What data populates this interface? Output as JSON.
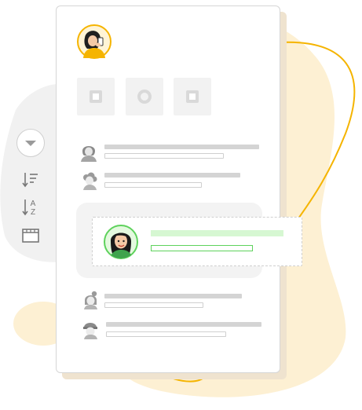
{
  "illustration": {
    "toolbar_tiles": [
      "square-stop-icon",
      "circle-record-icon",
      "square-stop-icon"
    ],
    "list_rows": [
      {
        "avatar": "woman-short-hair-avatar"
      },
      {
        "avatar": "woman-curly-hair-avatar"
      },
      {
        "avatar": "woman-dark-hair-avatar",
        "selected": true
      },
      {
        "avatar": "woman-bun-hair-avatar"
      },
      {
        "avatar": "woman-beanie-avatar"
      }
    ],
    "side_tools": [
      "dropdown-icon",
      "sort-descending-icon",
      "sort-a-z-icon",
      "calendar-icon"
    ],
    "sort_letters": {
      "top": "A",
      "bottom": "Z"
    },
    "colors": {
      "accent_yellow": "#f5b400",
      "blob_cream": "#fdf0d3",
      "blob_gray": "#f1f1f1",
      "selected_green": "#d6f7d2",
      "selected_green_line": "#5ed25c"
    }
  }
}
